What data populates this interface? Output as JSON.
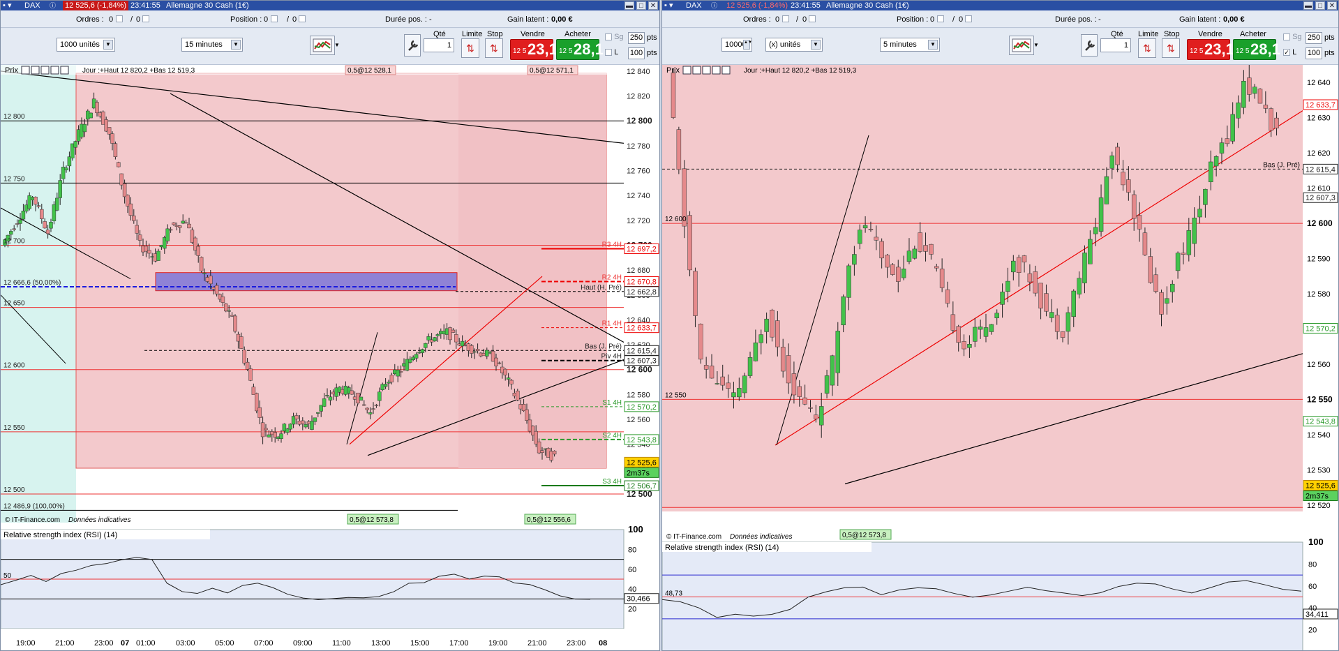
{
  "windows": [
    {
      "id": "w1",
      "instrument": "DAX",
      "price_badge": "12 525,6 (-1,84%)",
      "time": "23:41:55",
      "title": "Allemagne 30 Cash (1€)",
      "orders_label": "Ordres :",
      "orders_val": "0",
      "orders_sep": "/",
      "orders_val2": "0",
      "position_label": "Position :",
      "position_val": "0",
      "position_val2": "0",
      "duration_label": "Durée pos. :",
      "duration_val": "-",
      "gain_label": "Gain latent :",
      "gain_val": "0,00 €",
      "units": "1000 unités",
      "units_val": "",
      "units_suffix": "",
      "timeframe": "15 minutes",
      "qty_label": "Qté",
      "qty_val": "1",
      "limit_label": "Limite",
      "stop_label": "Stop",
      "sell_label": "Vendre",
      "sell_small": "12 5",
      "sell_big": "23,1",
      "buy_label": "Acheter",
      "buy_small": "12 5",
      "buy_big": "28,1",
      "sg_label": "Sg",
      "sg_val": "250",
      "l_label": "L",
      "l_val": "100",
      "pts": "pts",
      "chart_header": "Jour :+Haut 12 820,2 +Bas 12 519,3",
      "prix": "Prix",
      "top_tag1": "0,5@12 528,1",
      "top_tag2": "0,5@12 571,1",
      "bottom_tag1": "0,5@12 573,8",
      "bottom_tag2": "0,5@12 556,6",
      "credit": "© IT-Finance.com",
      "credit_note": "Données indicatives",
      "rsi_label": "Relative strength index (RSI) (14)",
      "rsi_val": "30,466",
      "rsi_mid": "50",
      "price_axis": [
        "12 840",
        "12 820",
        "12 800",
        "12 780",
        "12 760",
        "12 740",
        "12 720",
        "12 700",
        "12 680",
        "12 660",
        "12 640",
        "12 620",
        "12 600",
        "12 580",
        "12 560",
        "12 540",
        "12 520",
        "12 500"
      ],
      "rsi_axis": [
        "100",
        "80",
        "60",
        "40",
        "20"
      ],
      "left_labels": [
        "12 800",
        "12 750",
        "12 700",
        "12 666,6 (50,00%)",
        "12 650",
        "12 600",
        "12 550",
        "12 500",
        "12 486,9 (100,00%)"
      ],
      "line_labels": [
        "R3 4H",
        "R2 4H",
        "Haut (H. Pré)",
        "R1 4H",
        "Bas (J. Pré)",
        "Piv 4H",
        "S1 4H",
        "S2 4H",
        "S3 4H"
      ],
      "boxes": [
        "12 697,2",
        "12 670,8",
        "12 662,8",
        "12 633,7",
        "12 615,4",
        "12 607,3",
        "12 570,2",
        "12 543,8",
        "12 525,6",
        "2m37s",
        "12 506,7"
      ],
      "time_axis": [
        "19:00",
        "21:00",
        "23:00",
        "07",
        "01:00",
        "03:00",
        "05:00",
        "07:00",
        "09:00",
        "11:00",
        "13:00",
        "15:00",
        "17:00",
        "19:00",
        "21:00",
        "23:00",
        "08"
      ]
    },
    {
      "id": "w2",
      "instrument": "DAX",
      "price_badge": "12 525,6 (-1,84%)",
      "time": "23:41:55",
      "title": "Allemagne 30 Cash (1€)",
      "orders_label": "Ordres :",
      "orders_val": "0",
      "orders_sep": "/",
      "orders_val2": "0",
      "position_label": "Position :",
      "position_val": "0",
      "position_val2": "0",
      "duration_label": "Durée pos. :",
      "duration_val": "-",
      "gain_label": "Gain latent :",
      "gain_val": "0,00 €",
      "units": "",
      "units_val": "10000",
      "units_suffix": "(x) unités",
      "timeframe": "5 minutes",
      "qty_label": "Qté",
      "qty_val": "1",
      "limit_label": "Limite",
      "stop_label": "Stop",
      "sell_label": "Vendre",
      "sell_small": "12 5",
      "sell_big": "23,1",
      "buy_label": "Acheter",
      "buy_small": "12 5",
      "buy_big": "28,1",
      "sg_label": "Sg",
      "sg_val": "250",
      "l_label": "L",
      "l_val": "100",
      "pts": "pts",
      "chart_header": "Jour :+Haut 12 820,2 +Bas 12 519,3",
      "prix": "Prix",
      "top_tag1": "",
      "top_tag2": "",
      "bottom_tag1": "0,5@12 573,8",
      "bottom_tag2": "",
      "credit": "© IT-Finance.com",
      "credit_note": "Données indicatives",
      "rsi_label": "Relative strength index (RSI) (14)",
      "rsi_val": "34,411",
      "rsi_mid": "48,73",
      "price_axis": [
        "12 640",
        "12 630",
        "12 620",
        "12 610",
        "12 600",
        "12 590",
        "12 580",
        "12 570",
        "12 560",
        "12 550",
        "12 540",
        "12 530",
        "12 520"
      ],
      "rsi_axis": [
        "100",
        "80",
        "60",
        "40",
        "20"
      ],
      "left_labels": [
        "12 600",
        "12 550"
      ],
      "line_labels": [
        "Bas (J. Pré)"
      ],
      "boxes": [
        "12 633,7",
        "12 615,4",
        "12 607,3",
        "12 570,2",
        "12 543,8",
        "12 525,6",
        "2m37s"
      ],
      "time_axis": []
    }
  ]
}
